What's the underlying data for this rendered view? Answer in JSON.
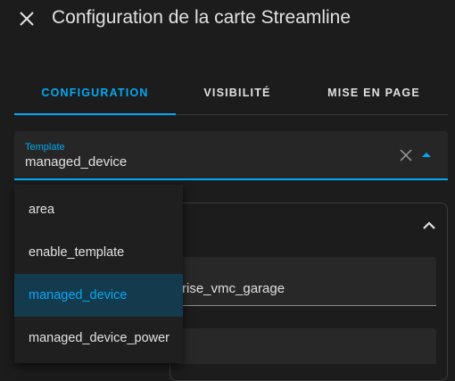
{
  "dialog": {
    "title": "Configuration de la carte Streamline",
    "close_icon": "close-icon"
  },
  "tabs": [
    {
      "label": "CONFIGURATION",
      "active": true
    },
    {
      "label": "VISIBILITÉ"
    },
    {
      "label": "MISE EN PAGE"
    }
  ],
  "template_field": {
    "label": "Template",
    "value": "managed_device"
  },
  "dropdown": {
    "options": [
      "area",
      "enable_template",
      "managed_device",
      "managed_device_power"
    ],
    "selected": "managed_device"
  },
  "background": {
    "entity_value": "rise_vmc_garage"
  },
  "colors": {
    "accent": "#03a9f4",
    "selected_bg": "#133a4d",
    "background": "#1c1c1c"
  }
}
